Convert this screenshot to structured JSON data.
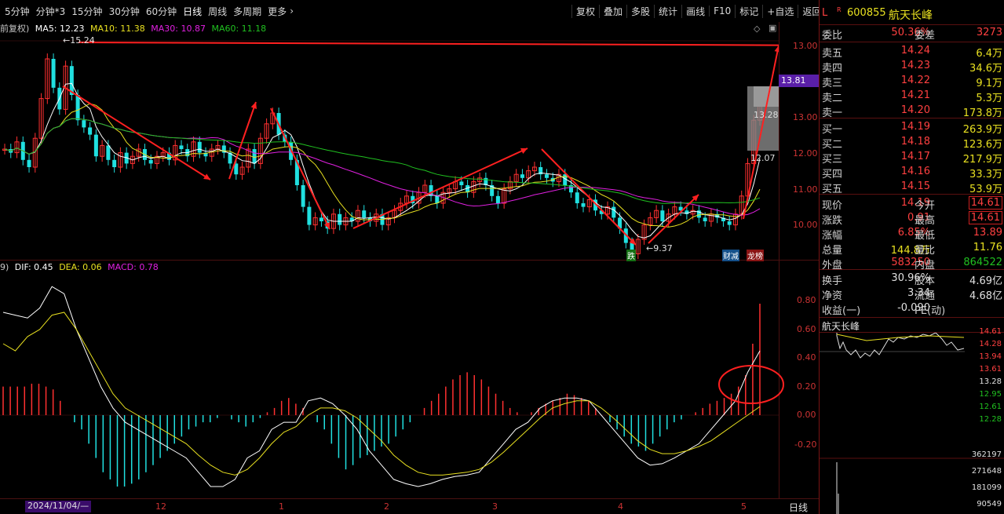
{
  "toolbar": {
    "periods": [
      "5分钟",
      "分钟*3",
      "15分钟",
      "30分钟",
      "60分钟",
      "日线",
      "周线",
      "多周期",
      "更多"
    ],
    "active_period": "日线",
    "right_buttons": [
      "复权",
      "叠加",
      "多股",
      "统计",
      "画线",
      "F10",
      "标记",
      "+自选",
      "返回"
    ]
  },
  "ma_line": {
    "prefix": "前复权)",
    "ma5": "MA5: 12.23",
    "ma10": "MA10: 11.38",
    "ma30": "MA30: 10.87",
    "ma60": "MA60: 11.18"
  },
  "main_axis": [
    "13.00",
    "12.00",
    "11.00",
    "10.00"
  ],
  "price_tag": "13.81",
  "high_label": "15.24",
  "low_label": "9.37",
  "gap_labels": [
    "13.28",
    "12.07"
  ],
  "event_labels": {
    "die": "跌",
    "caijian": "财减",
    "longhu": "龙榜"
  },
  "macd_line": {
    "prefix": "9)",
    "dif": "DIF: 0.45",
    "dea": "DEA: 0.06",
    "macd": "MACD: 0.78"
  },
  "macd_axis": [
    "0.80",
    "0.60",
    "0.40",
    "0.20",
    "0.00",
    "-0.20"
  ],
  "date_axis": {
    "first": "2024/11/04/—",
    "months": [
      "12",
      "1",
      "2",
      "3",
      "4",
      "5"
    ],
    "period": "日线"
  },
  "colors": {
    "up": "#ff3030",
    "down": "#20e0e0",
    "ma5": "#ffffff",
    "ma10": "#e8e020",
    "ma30": "#e020e0",
    "ma60": "#20c020"
  },
  "chart_data": {
    "type": "candlestick",
    "series": [
      {
        "name": "MA5"
      },
      {
        "name": "MA10"
      },
      {
        "name": "MA30"
      },
      {
        "name": "MA60"
      }
    ],
    "key_points": [
      {
        "label": "high",
        "value": 15.24
      },
      {
        "label": "low",
        "value": 9.37
      },
      {
        "label": "last",
        "value": 13.81
      }
    ],
    "macd": {
      "dif": 0.45,
      "dea": 0.06,
      "macd": 0.78
    }
  },
  "quote": {
    "code": "600855",
    "name": "航天长峰",
    "weibi_label": "委比",
    "weibi": "50.36%",
    "weicha_label": "委差",
    "weicha": "3273",
    "asks": [
      {
        "label": "卖五",
        "price": "14.24",
        "vol": "6.4万"
      },
      {
        "label": "卖四",
        "price": "14.23",
        "vol": "34.6万"
      },
      {
        "label": "卖三",
        "price": "14.22",
        "vol": "9.1万"
      },
      {
        "label": "卖二",
        "price": "14.21",
        "vol": "5.3万"
      },
      {
        "label": "卖一",
        "price": "14.20",
        "vol": "173.8万"
      }
    ],
    "bids": [
      {
        "label": "买一",
        "price": "14.19",
        "vol": "263.9万"
      },
      {
        "label": "买二",
        "price": "14.18",
        "vol": "123.6万"
      },
      {
        "label": "买三",
        "price": "14.17",
        "vol": "217.9万"
      },
      {
        "label": "买四",
        "price": "14.16",
        "vol": "33.3万"
      },
      {
        "label": "买五",
        "price": "14.15",
        "vol": "53.9万"
      }
    ],
    "stats": [
      {
        "l1": "现价",
        "v1": "14.19",
        "l2": "今开",
        "v2": "14.61"
      },
      {
        "l1": "涨跌",
        "v1": "0.91",
        "l2": "最高",
        "v2": "14.61"
      },
      {
        "l1": "涨幅",
        "v1": "6.85%",
        "l2": "最低",
        "v2": "13.89"
      },
      {
        "l1": "总量",
        "v1": "144.8万",
        "l2": "量比",
        "v2": "11.76"
      },
      {
        "l1": "外盘",
        "v1": "583250",
        "l2": "内盘",
        "v2": "864522"
      }
    ],
    "stats2": [
      {
        "l1": "换手",
        "v1": "30.96%",
        "l2": "股本",
        "v2": "4.69亿"
      },
      {
        "l1": "净资",
        "v1": "3.34",
        "l2": "流通",
        "v2": "4.68亿"
      },
      {
        "l1": "收益(一)",
        "v1": "-0.090",
        "l2": "PE(动)",
        "v2": ""
      }
    ],
    "mini_title": "航天长峰",
    "mini_axis": [
      "14.61",
      "14.28",
      "13.94",
      "13.61",
      "13.28",
      "12.95",
      "12.61",
      "12.28"
    ],
    "vol_axis": [
      "362197",
      "271648",
      "181099",
      "90549"
    ]
  }
}
